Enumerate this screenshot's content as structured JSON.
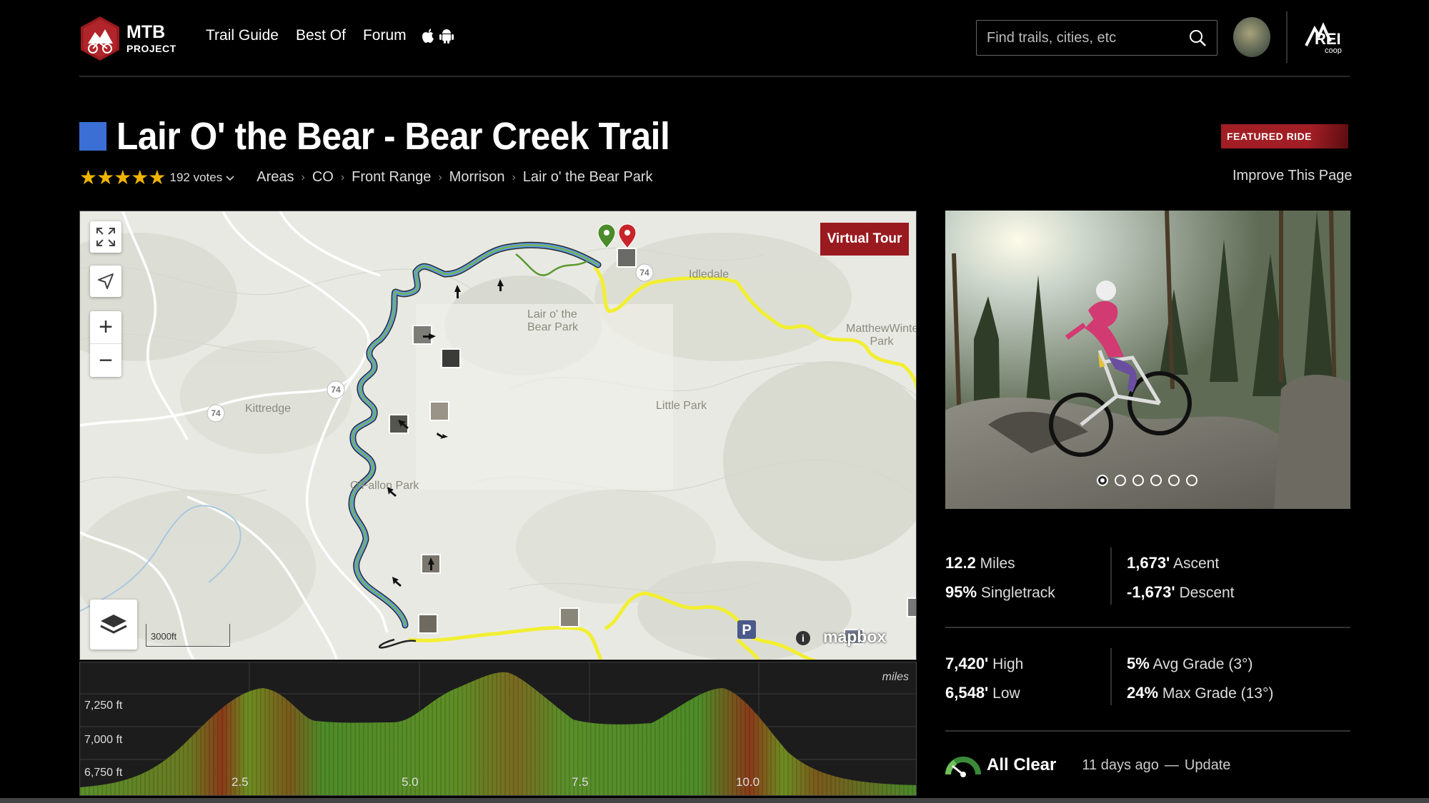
{
  "header": {
    "logo_line1": "MTB",
    "logo_line2": "PROJECT",
    "nav": [
      "Trail Guide",
      "Best Of",
      "Forum"
    ],
    "search_placeholder": "Find trails, cities, etc",
    "partner": "REI co-op"
  },
  "trail": {
    "difficulty_color": "#3b6fd6",
    "title": "Lair O' the Bear - Bear Creek Trail",
    "featured_label": "FEATURED RIDE",
    "stars": "★★★★★",
    "votes": "192 votes",
    "breadcrumbs": [
      "Areas",
      "CO",
      "Front Range",
      "Morrison",
      "Lair o' the Bear Park"
    ],
    "improve_link": "Improve This Page"
  },
  "map": {
    "virtual_tour": "Virtual Tour",
    "scale": "3000ft",
    "attribution": "mapbox",
    "labels": {
      "kittredge": "Kittredge",
      "lair_park": "Lair o' the Bear Park",
      "idledale": "Idledale",
      "little_park": "Little Park",
      "ofallon": "O'Fallon Park",
      "matthew": "MatthewWinters Park"
    },
    "route_shields": [
      "74",
      "74",
      "74"
    ]
  },
  "elevation": {
    "unit_label": "miles",
    "y_ticks": [
      "7,250 ft",
      "7,000 ft",
      "6,750 ft"
    ],
    "x_ticks": [
      "2.5",
      "5.0",
      "7.5",
      "10.0"
    ]
  },
  "photo": {
    "slide_count": 6,
    "active_slide": 1
  },
  "stats": {
    "distance_value": "12.2",
    "distance_unit": "Miles",
    "singletrack_value": "95%",
    "singletrack_label": "Singletrack",
    "ascent_value": "1,673'",
    "ascent_label": "Ascent",
    "descent_value": "-1,673'",
    "descent_label": "Descent",
    "high_value": "7,420'",
    "high_label": "High",
    "low_value": "6,548'",
    "low_label": "Low",
    "avg_grade_value": "5%",
    "avg_grade_label": "Avg Grade (3°)",
    "max_grade_value": "24%",
    "max_grade_label": "Max Grade (13°)"
  },
  "conditions": {
    "status": "All Clear",
    "updated": "11 days ago",
    "dash": "—",
    "update_link": "Update"
  }
}
